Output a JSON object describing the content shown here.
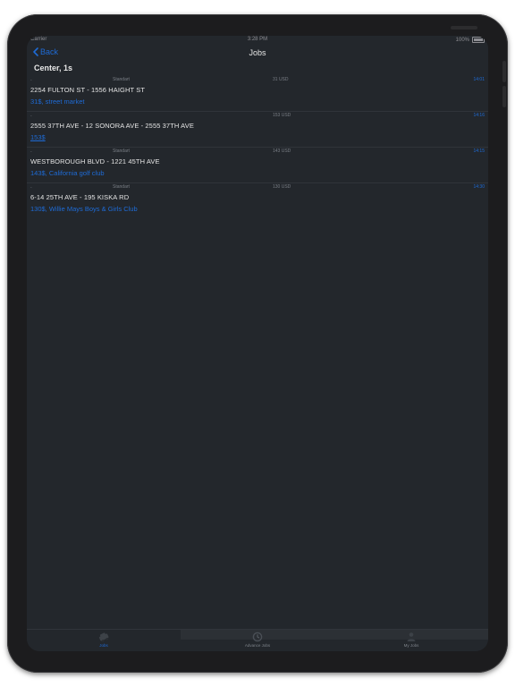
{
  "status_bar": {
    "carrier": "Carrier",
    "time": "3:28 PM",
    "battery": "100%"
  },
  "nav": {
    "back_label": "Back",
    "title": "Jobs"
  },
  "section_title": "Center, 1s",
  "jobs": [
    {
      "dash": "-",
      "type": "Standart",
      "price": "31 USD",
      "time": "14:01",
      "route": "2254 FULTON ST - 1556 HAIGHT ST",
      "info": "31$, street market"
    },
    {
      "dash": "-",
      "type": "",
      "price": "153 USD",
      "time": "14:16",
      "route": "2555 37TH AVE - 12 SONORA AVE - 2555 37TH AVE",
      "info": "153$"
    },
    {
      "dash": "-",
      "type": "Standart",
      "price": "143 USD",
      "time": "14:15",
      "route": "WESTBOROUGH BLVD - 1221 45TH AVE",
      "info": "143$, California golf club"
    },
    {
      "dash": "-",
      "type": "Standart",
      "price": "130 USD",
      "time": "14:30",
      "route": "6-14 25TH AVE - 195 KISKA RD",
      "info": "130$, Willie Mays Boys & Girls Club"
    }
  ],
  "tabs": [
    {
      "label": "Jobs",
      "icon": "car-icon"
    },
    {
      "label": "Advance Jobs",
      "icon": "clock-icon"
    },
    {
      "label": "My Jobs",
      "icon": "person-icon"
    }
  ],
  "colors": {
    "accent": "#1e6bd6",
    "background": "#23272c"
  }
}
